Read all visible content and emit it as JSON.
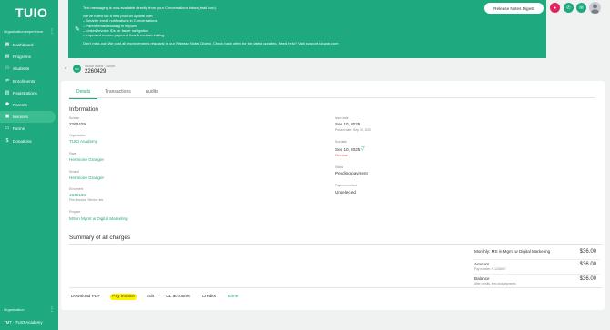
{
  "sidebar": {
    "logo": "TUIO",
    "org_section_label": "Organization experience",
    "items": [
      {
        "label": "Dashboard",
        "icon": "grid-icon"
      },
      {
        "label": "Programs",
        "icon": "calendar-icon"
      },
      {
        "label": "Students",
        "icon": "students-icon"
      },
      {
        "label": "Enrollments",
        "icon": "enrollments-icon"
      },
      {
        "label": "Registrations",
        "icon": "registrations-icon"
      },
      {
        "label": "Parents",
        "icon": "parents-icon"
      },
      {
        "label": "Invoices",
        "icon": "invoice-icon",
        "active": true
      },
      {
        "label": "Forms",
        "icon": "forms-icon"
      },
      {
        "label": "Donations",
        "icon": "dollar-icon"
      }
    ],
    "bottom_label": "Organization",
    "bottom_org": "TMT · TUIO Academy"
  },
  "banner": {
    "line1": "Text messaging is now available directly from your Conversations inbox (mail icon).",
    "line2": "We've rolled out a new product update with:",
    "bullets": [
      "– Smarter email notifications in Conversations",
      "– Parent email tracking in exports",
      "– Linked invoice IDs for faster navigation",
      "– Improved invoice payment flow & method editing"
    ],
    "footer": "Don't miss out: We post all improvements regularly in our Release Notes Digest. Check back often for the latest updates. Need help? Visit support.tuiopay.com"
  },
  "topbar": {
    "release_button": "Release Notes Digest",
    "icon_colors": {
      "record": "#e0245e",
      "chat": "#1fa97e",
      "mail": "#1fa97e"
    }
  },
  "header": {
    "back": "‹",
    "badge": "INV",
    "breadcrumb": "Invoice details · Invoice",
    "invoice_number": "2260429"
  },
  "tabs": [
    "Details",
    "Transactions",
    "Audits"
  ],
  "information": {
    "title": "Information",
    "left": [
      {
        "label": "Number",
        "value": "2260429",
        "type": "text"
      },
      {
        "label": "Organization",
        "value": "TUIO Academy",
        "type": "link"
      },
      {
        "label": "Payer",
        "value": "Hermione Granger",
        "type": "link"
      },
      {
        "label": "Student",
        "value": "Hermione Granger",
        "type": "link"
      },
      {
        "label": "Enrollment",
        "value": "1845133",
        "type": "link",
        "sub": "Fee: Invoice, Service fee"
      },
      {
        "label": "Program",
        "value": "MS in Mgmt w Digital Marketing",
        "type": "link"
      }
    ],
    "right": {
      "issue_label": "Issue date",
      "issue_value": "Sep 10, 2025",
      "issue_sub": "Posted date: Sep 10, 2025",
      "due_label": "Due date",
      "due_value": "Sep 10, 2025",
      "due_status": "Overdue",
      "status_label": "Status",
      "status_value": "Pending payment",
      "payment_label": "Payment method",
      "payment_value": "Unselected"
    }
  },
  "summary": {
    "title": "Summary of all charges",
    "rows": [
      {
        "name": "Monthly: MS in Mgmt w Digital Marketing",
        "sub": "",
        "amount": "$36.00"
      },
      {
        "name": "Amount",
        "sub": "Pay number: P-1234567",
        "amount": "$36.00"
      },
      {
        "name": "Balance",
        "sub": "After credits, fees and payments",
        "amount": "$36.00"
      }
    ]
  },
  "actions": {
    "download": "Download PDF",
    "pay": "Pay invoice",
    "edit": "Edit",
    "gl": "GL accounts",
    "credits": "Credits",
    "done": "Done"
  }
}
